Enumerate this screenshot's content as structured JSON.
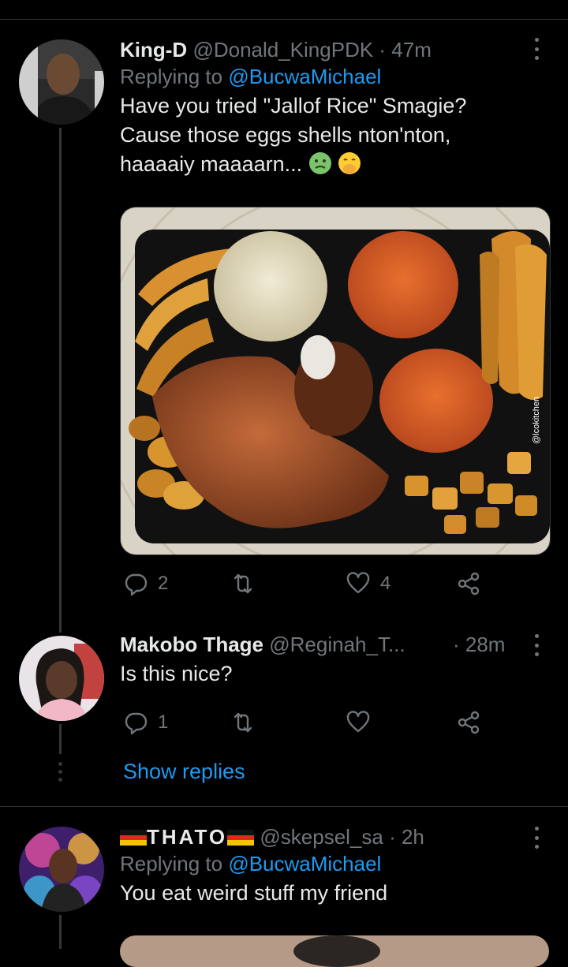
{
  "tweets": [
    {
      "name": "King-D",
      "handle": "@Donald_KingPDK",
      "time": "· 47m",
      "replying_prefix": "Replying to",
      "replying_to": "@BucwaMichael",
      "text_lines": [
        "Have you tried \"Jallof Rice\" Smagie?",
        "Cause those eggs shells nton'nton,",
        "haaaaiy maaaarn..."
      ],
      "emojis": [
        "nauseated-face-emoji",
        "hand-over-mouth-emoji"
      ],
      "media_watermark": "@lcokitchen",
      "actions": {
        "reply_count": "2",
        "retweet_count": "",
        "like_count": "4"
      }
    },
    {
      "name": "Makobo Thage",
      "handle": "@Reginah_T...",
      "time": "· 28m",
      "text": "Is this nice?",
      "actions": {
        "reply_count": "1",
        "retweet_count": "",
        "like_count": ""
      }
    },
    {
      "name": "THATO",
      "handle": "@skepsel_sa",
      "time": "· 2h",
      "replying_prefix": "Replying to",
      "replying_to": "@BucwaMichael",
      "text": "You eat weird stuff my friend"
    }
  ],
  "show_replies": "Show replies",
  "colors": {
    "background": "#000000",
    "text": "#e7e9ea",
    "muted": "#71767b",
    "link": "#1d9bf0",
    "divider": "#2f3336"
  },
  "icons": [
    "reply-icon",
    "retweet-icon",
    "like-icon",
    "share-icon",
    "more-icon"
  ]
}
